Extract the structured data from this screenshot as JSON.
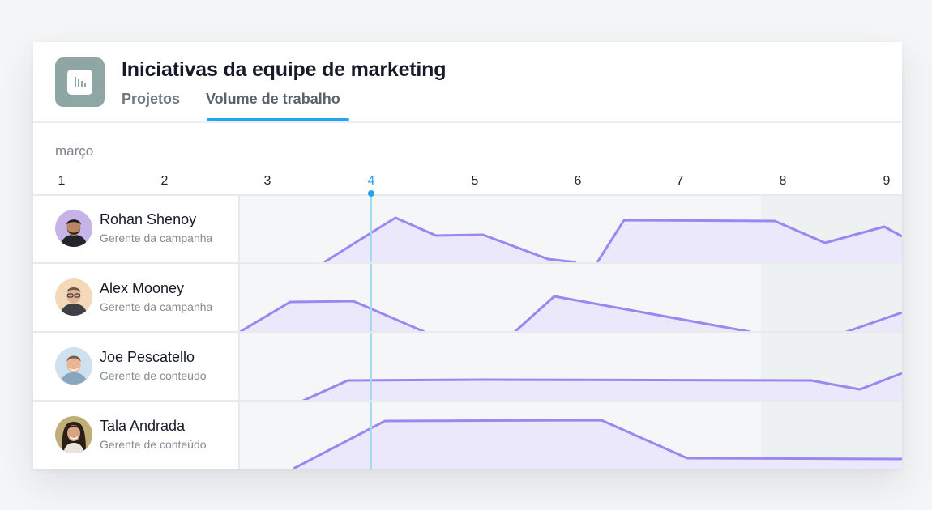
{
  "project": {
    "title": "Iniciativas da equipe de marketing",
    "icon": "bar-chart-icon",
    "icon_color": "#8ea7a5"
  },
  "tabs": [
    {
      "label": "Projetos",
      "active": false
    },
    {
      "label": "Volume de trabalho",
      "active": true
    }
  ],
  "accent_color": "#27a5e8",
  "timeline": {
    "month": "março",
    "days": [
      "1",
      "2",
      "3",
      "4",
      "5",
      "6",
      "7",
      "8",
      "9"
    ],
    "today": "4"
  },
  "people": [
    {
      "name": "Rohan Shenoy",
      "role": "Gerente da campanha",
      "avatar": "avatar-rohan"
    },
    {
      "name": "Alex Mooney",
      "role": "Gerente da campanha",
      "avatar": "avatar-alex"
    },
    {
      "name": "Joe Pescatello",
      "role": "Gerente de conteúdo",
      "avatar": "avatar-joe"
    },
    {
      "name": "Tala Andrada",
      "role": "Gerente de conteúdo",
      "avatar": "avatar-tala"
    }
  ],
  "workload_color": "#9a87f0"
}
